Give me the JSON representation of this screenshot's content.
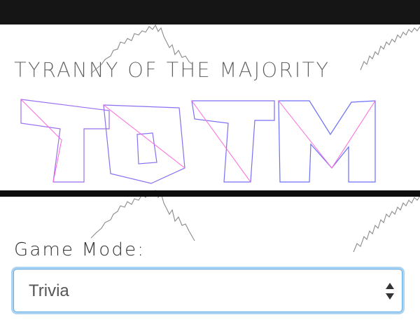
{
  "app": {
    "title": "TYRANNY OF THE MAJORITY",
    "logo_text": "TOTM"
  },
  "form": {
    "game_mode_label": "Game Mode:",
    "game_mode_selected": "Trivia"
  },
  "colors": {
    "top_bar": "#151515",
    "divider": "#0d0d0d",
    "logo_pink": "#ff4fd8",
    "logo_purple": "#b07cf0",
    "logo_blue": "#5a6cf5",
    "focus_ring": "#66afe9",
    "sparkline": "#888888"
  },
  "icons": {
    "select_arrows": "up-down-caret-icon"
  }
}
